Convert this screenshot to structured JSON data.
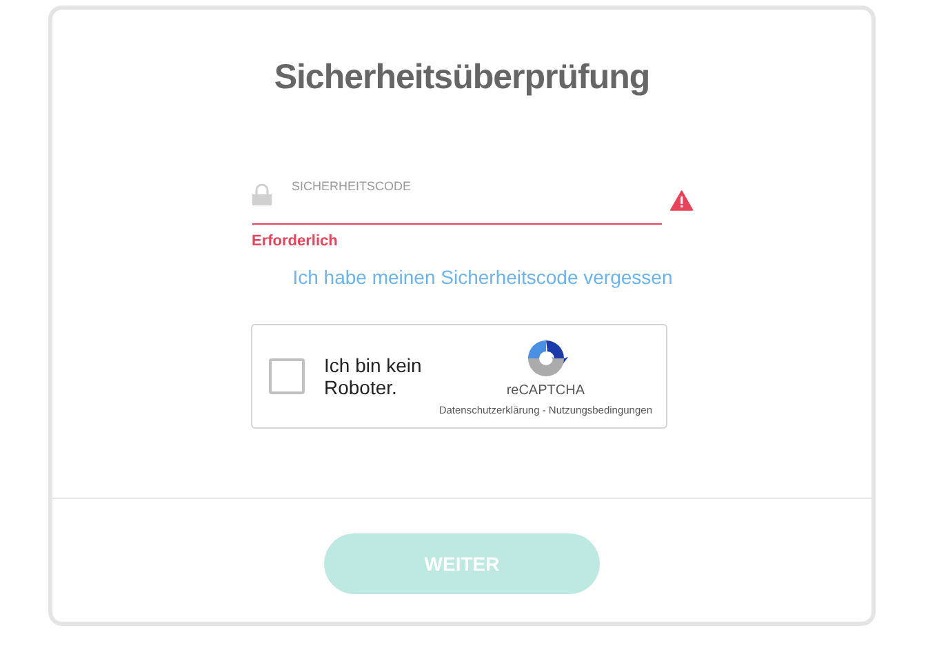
{
  "title": "Sicherheitsüberprüfung",
  "field": {
    "label": "SICHERHEITSCODE",
    "error": true,
    "error_text": "Erforderlich"
  },
  "forgot_link": "Ich habe meinen Sicherheitscode vergessen",
  "captcha": {
    "checked": false,
    "label": "Ich bin kein Roboter.",
    "brand": "reCAPTCHA",
    "legal": "Datenschutzerklärung - Nutzungsbedingungen"
  },
  "submit": {
    "label": "WEITER",
    "disabled": true
  }
}
